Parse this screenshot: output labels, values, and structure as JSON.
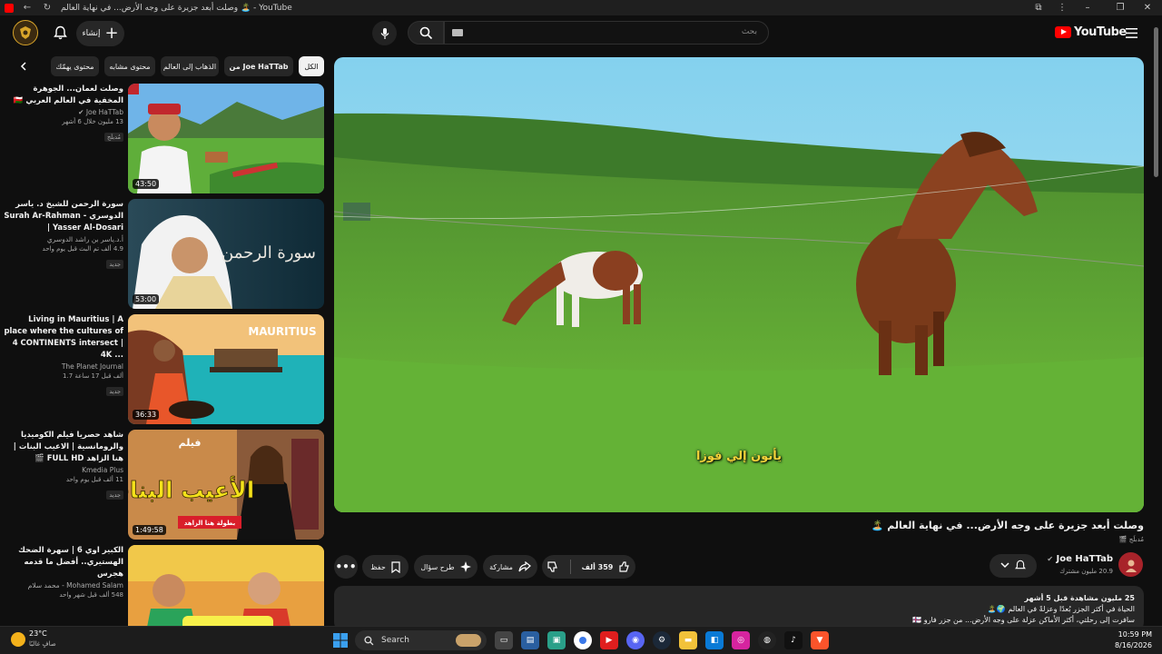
{
  "window": {
    "title": "وصلت أبعد جزيرة على وجه الأرض... في نهاية العالم 🏝️ - YouTube"
  },
  "header": {
    "create_label": "إنشاء",
    "search_placeholder": "بحث",
    "logo_text": "YouTube"
  },
  "chips": [
    "الكل",
    "من Joe HaTTab",
    "الذهاب إلى العالم",
    "محتوى مشابه",
    "محتوى يهمّك"
  ],
  "player": {
    "subtitle": "يأتون إلي فوزا"
  },
  "video": {
    "title": "وصلت أبعد جزيرة على وجه الأرض... في نهاية العالم 🏝️",
    "tag": "🎬 مُدبلَج",
    "channel_name": "Joe HaTTab",
    "subscribers": "20.9 مليون مشترك",
    "likes": "359 ألف",
    "share_label": "مشاركة",
    "ask_label": "طرح سؤال",
    "save_label": "حفظ"
  },
  "description": {
    "views_line": "25 مليون مشاهدة  قبل 5 أشهر",
    "line2": "الحياة في أكثر الجزر بُعدًا وعزلةً في العالم 🌍🏝️",
    "line3": "سافرت إلى رحلتي، أكثر الأماكن عزلة على وجه الأرض... من جزر فارو 🇫🇴"
  },
  "recommendations": [
    {
      "title": "وصلت لعمان... الجوهرة المخفية في العالم العربي 🇴🇲",
      "channel": "Joe HaTTab",
      "meta": "13 مليون  خلال 6 أشهر",
      "badge": "مُدبلَج",
      "duration": "43:50"
    },
    {
      "title": "سورة الرحمن للشيخ د. ياسر الدوسري - Surah Ar-Rahman | Yasser Al-Dosari",
      "channel": "أ.د.ياسر بن راشد الدوسري",
      "meta": "4.9 ألف  تم البث قبل يوم واحد",
      "badge": "جديد",
      "duration": "53:00"
    },
    {
      "title": "Living in Mauritius | A place where the cultures of 4 CONTINENTS intersect | 4K ...",
      "channel": "The Planet Journal",
      "meta": "1.7 ألف  قبل 17 ساعة",
      "badge": "جديد",
      "duration": "36:33"
    },
    {
      "title": "شاهد حصريا فيلم الكوميديا والرومانسية | الاعيب البنات | هنا الزاهد FULL HD 🎬",
      "channel": "Kmedia Plus",
      "meta": "11 ألف  قبل يوم واحد",
      "badge": "جديد",
      "duration": "1:49:58"
    },
    {
      "title": "الكبير اوي 6 | سهرة الضحك الهستيري.. أفضل ما قدمه هجرس",
      "channel": "Mohamed Salam - محمد سلام",
      "meta": "548 ألف  قبل شهر واحد",
      "badge": "",
      "duration": ""
    }
  ],
  "thumb_texts": {
    "mauritius": "MAURITIUS",
    "movie_small": "فيلم",
    "movie_big": "الأعيب البنات",
    "movie_tag": "بطولة هنا الزاهد",
    "surah": "سورة الرحمن"
  },
  "taskbar": {
    "weather_temp": "23°C",
    "weather_text": "صافٍ غالبًا",
    "search_label": "Search",
    "time": "10:59 PM",
    "date": "8/16/2026"
  }
}
